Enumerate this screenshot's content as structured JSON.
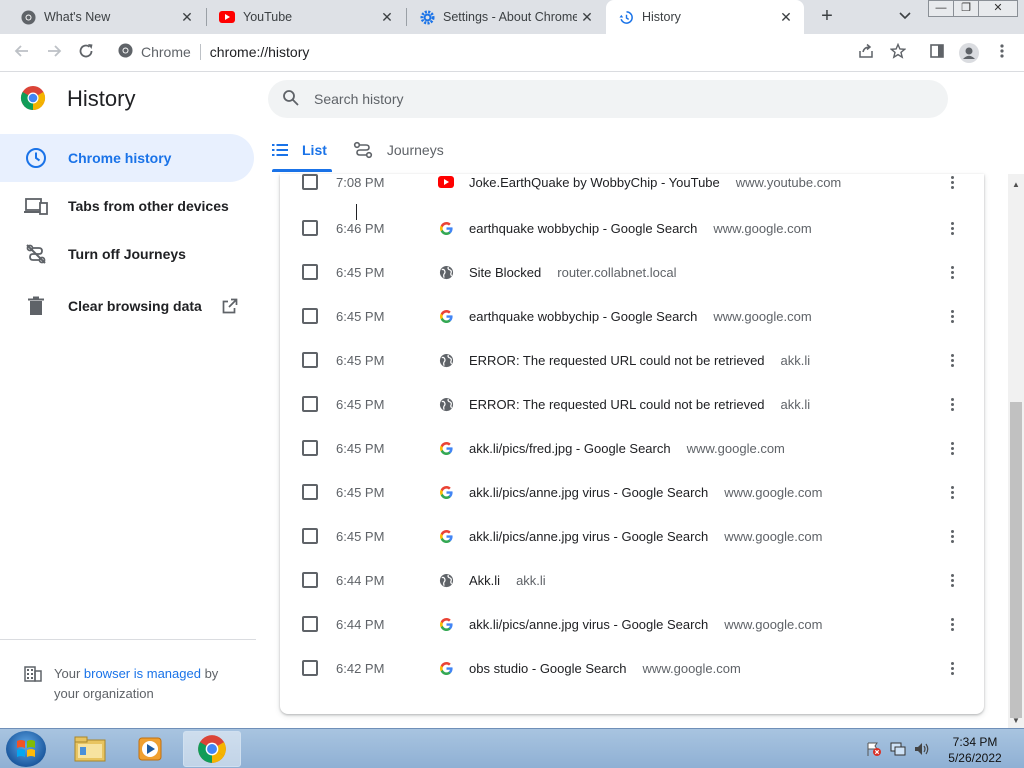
{
  "browser": {
    "tabs": [
      {
        "title": "What's New",
        "icon": "chrome-icon",
        "active": false
      },
      {
        "title": "YouTube",
        "icon": "youtube-icon",
        "active": false
      },
      {
        "title": "Settings - About Chrome",
        "icon": "settings-gear-icon",
        "active": false
      },
      {
        "title": "History",
        "icon": "history-icon",
        "active": true
      }
    ],
    "close_glyph": "✕",
    "new_tab_glyph": "+",
    "omnibox": {
      "scheme_label": "Chrome",
      "url": "chrome://history"
    }
  },
  "history_page": {
    "title": "History",
    "search_placeholder": "Search history",
    "sidebar": [
      {
        "label": "Chrome history",
        "icon": "clock-icon",
        "selected": true
      },
      {
        "label": "Tabs from other devices",
        "icon": "devices-icon",
        "selected": false
      },
      {
        "label": "Turn off Journeys",
        "icon": "journeys-off-icon",
        "selected": false
      },
      {
        "label": "Clear browsing data",
        "icon": "trash-icon",
        "selected": false
      }
    ],
    "managed": {
      "prefix": "Your ",
      "link": "browser is managed",
      "suffix": " by your organization"
    },
    "tabs": [
      {
        "label": "List",
        "active": true
      },
      {
        "label": "Journeys",
        "active": false
      }
    ],
    "entries": [
      {
        "time": "7:08 PM",
        "title": "Joke.EarthQuake by WobbyChip - YouTube",
        "domain": "www.youtube.com",
        "icon": "youtube"
      },
      {
        "time": "6:46 PM",
        "title": "earthquake wobbychip - Google Search",
        "domain": "www.google.com",
        "icon": "google"
      },
      {
        "time": "6:45 PM",
        "title": "Site Blocked",
        "domain": "router.collabnet.local",
        "icon": "globe"
      },
      {
        "time": "6:45 PM",
        "title": "earthquake wobbychip - Google Search",
        "domain": "www.google.com",
        "icon": "google"
      },
      {
        "time": "6:45 PM",
        "title": "ERROR: The requested URL could not be retrieved",
        "domain": "akk.li",
        "icon": "globe"
      },
      {
        "time": "6:45 PM",
        "title": "ERROR: The requested URL could not be retrieved",
        "domain": "akk.li",
        "icon": "globe"
      },
      {
        "time": "6:45 PM",
        "title": "akk.li/pics/fred.jpg - Google Search",
        "domain": "www.google.com",
        "icon": "google"
      },
      {
        "time": "6:45 PM",
        "title": "akk.li/pics/anne.jpg virus - Google Search",
        "domain": "www.google.com",
        "icon": "google"
      },
      {
        "time": "6:45 PM",
        "title": "akk.li/pics/anne.jpg virus - Google Search",
        "domain": "www.google.com",
        "icon": "google"
      },
      {
        "time": "6:44 PM",
        "title": "Akk.li",
        "domain": "akk.li",
        "icon": "globe"
      },
      {
        "time": "6:44 PM",
        "title": "akk.li/pics/anne.jpg virus - Google Search",
        "domain": "www.google.com",
        "icon": "google"
      },
      {
        "time": "6:42 PM",
        "title": "obs studio - Google Search",
        "domain": "www.google.com",
        "icon": "google"
      }
    ]
  },
  "taskbar": {
    "clock_time": "7:34 PM",
    "clock_date": "5/26/2022",
    "pinned": [
      "explorer-folder-icon",
      "media-player-icon",
      "chrome-icon"
    ]
  },
  "colors": {
    "accent": "#1a73e8",
    "selected_bg": "#e8f0fe",
    "tabstrip": "#dee1e6"
  }
}
